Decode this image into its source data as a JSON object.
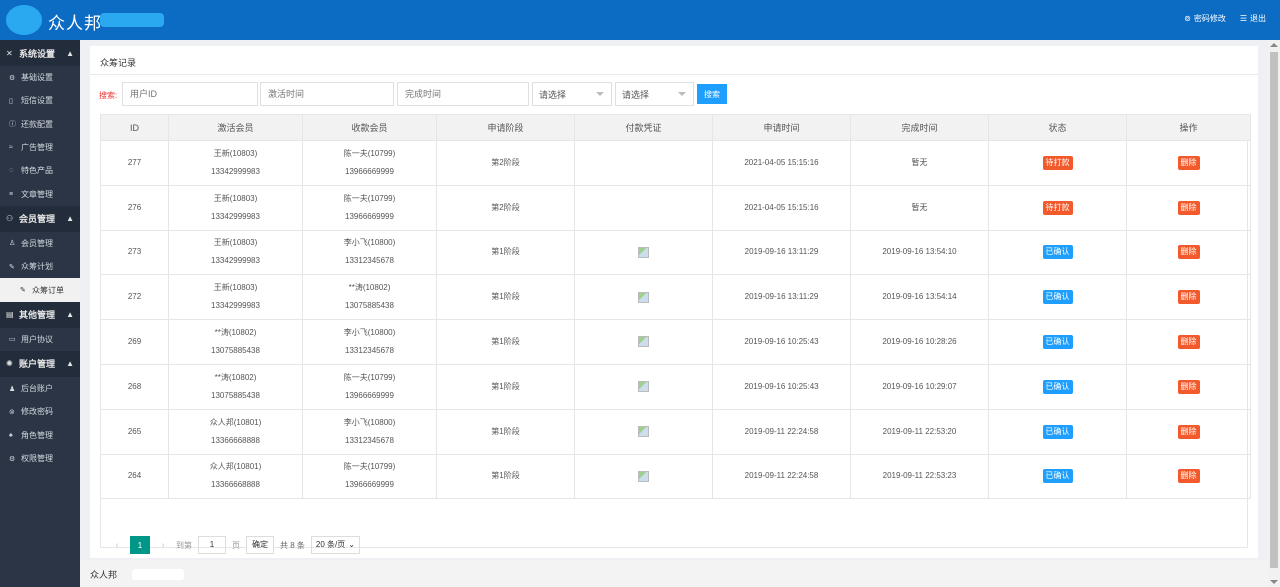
{
  "header": {
    "logo_text": "众人邦",
    "change_password": "密码修改",
    "logout": "退出"
  },
  "sidebar": {
    "groups": [
      {
        "label": "系统设置",
        "items": [
          "基础设置",
          "短信设置",
          "还款配置",
          "广告管理",
          "特色产品",
          "文章管理"
        ]
      },
      {
        "label": "会员管理",
        "items": [
          "会员管理",
          "众筹计划",
          "众筹订单"
        ]
      },
      {
        "label": "其他管理",
        "items": [
          "用户协议"
        ]
      },
      {
        "label": "账户管理",
        "items": [
          "后台账户",
          "修改密码",
          "角色管理",
          "权限管理"
        ]
      }
    ]
  },
  "panel": {
    "title": "众筹记录"
  },
  "search": {
    "label": "搜索:",
    "user_id_placeholder": "用户ID",
    "activate_time_placeholder": "激活时间",
    "complete_time_placeholder": "完成时间",
    "select1": "请选择",
    "select2": "请选择",
    "button": "搜索"
  },
  "table": {
    "headers": [
      "ID",
      "激活会员",
      "收款会员",
      "申请阶段",
      "付款凭证",
      "申请时间",
      "完成时间",
      "状态",
      "操作"
    ],
    "rows": [
      {
        "id": "277",
        "act_name": "王新(10803)",
        "act_phone": "13342999983",
        "rec_name": "陈一夫(10799)",
        "rec_phone": "13966669999",
        "stage": "第2阶段",
        "apply_time": "2021-04-05 15:15:16",
        "done_time": "暂无",
        "status": "待打款",
        "action": "删除"
      },
      {
        "id": "276",
        "act_name": "王新(10803)",
        "act_phone": "13342999983",
        "rec_name": "陈一夫(10799)",
        "rec_phone": "13966669999",
        "stage": "第2阶段",
        "apply_time": "2021-04-05 15:15:16",
        "done_time": "暂无",
        "status": "待打款",
        "action": "删除"
      },
      {
        "id": "273",
        "act_name": "王新(10803)",
        "act_phone": "13342999983",
        "rec_name": "李小飞(10800)",
        "rec_phone": "13312345678",
        "stage": "第1阶段",
        "apply_time": "2019-09-16 13:11:29",
        "done_time": "2019-09-16 13:54:10",
        "status": "已确认",
        "action": "删除"
      },
      {
        "id": "272",
        "act_name": "王新(10803)",
        "act_phone": "13342999983",
        "rec_name": "**涛(10802)",
        "rec_phone": "13075885438",
        "stage": "第1阶段",
        "apply_time": "2019-09-16 13:11:29",
        "done_time": "2019-09-16 13:54:14",
        "status": "已确认",
        "action": "删除"
      },
      {
        "id": "269",
        "act_name": "**涛(10802)",
        "act_phone": "13075885438",
        "rec_name": "李小飞(10800)",
        "rec_phone": "13312345678",
        "stage": "第1阶段",
        "apply_time": "2019-09-16 10:25:43",
        "done_time": "2019-09-16 10:28:26",
        "status": "已确认",
        "action": "删除"
      },
      {
        "id": "268",
        "act_name": "**涛(10802)",
        "act_phone": "13075885438",
        "rec_name": "陈一夫(10799)",
        "rec_phone": "13966669999",
        "stage": "第1阶段",
        "apply_time": "2019-09-16 10:25:43",
        "done_time": "2019-09-16 10:29:07",
        "status": "已确认",
        "action": "删除"
      },
      {
        "id": "265",
        "act_name": "众人邦(10801)",
        "act_phone": "13366668888",
        "rec_name": "李小飞(10800)",
        "rec_phone": "13312345678",
        "stage": "第1阶段",
        "apply_time": "2019-09-11 22:24:58",
        "done_time": "2019-09-11 22:53:20",
        "status": "已确认",
        "action": "删除"
      },
      {
        "id": "264",
        "act_name": "众人邦(10801)",
        "act_phone": "13366668888",
        "rec_name": "陈一夫(10799)",
        "rec_phone": "13966669999",
        "stage": "第1阶段",
        "apply_time": "2019-09-11 22:24:58",
        "done_time": "2019-09-11 22:53:23",
        "status": "已确认",
        "action": "删除"
      }
    ]
  },
  "pager": {
    "current": "1",
    "goto_label": "到第",
    "goto_value": "1",
    "page_unit": "页",
    "confirm": "确定",
    "total": "共 8 条",
    "page_size": "20 条/页"
  },
  "footer": {
    "text": "众人邦"
  },
  "colors": {
    "header": "#0c6cc4",
    "sidebar": "#2b3545",
    "primary": "#1e9fff",
    "danger": "#f2592b",
    "page_active": "#009688"
  }
}
